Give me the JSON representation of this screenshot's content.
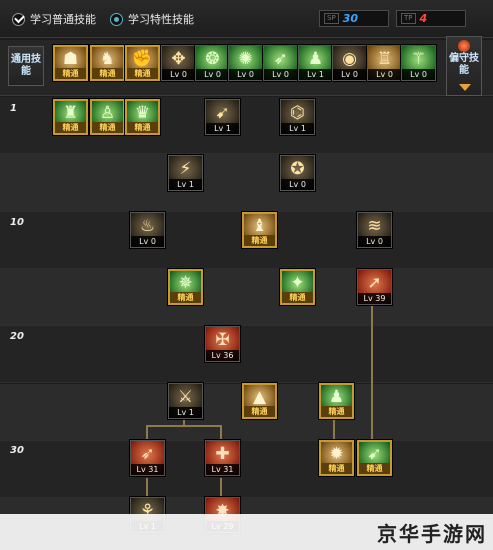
{
  "header": {
    "learn_common": "学习普通技能",
    "learn_trait": "学习特性技能",
    "sp": {
      "label": "SP",
      "value": "30"
    },
    "tp": {
      "label": "TP",
      "value": "4"
    }
  },
  "common_bar": {
    "button_label": "通用技能",
    "skills": [
      {
        "label": "精通",
        "mastered": true,
        "theme": "gold",
        "glyph": "☗"
      },
      {
        "label": "精通",
        "mastered": true,
        "theme": "gold",
        "glyph": "♞"
      },
      {
        "label": "精通",
        "mastered": true,
        "theme": "gold",
        "glyph": "✊"
      },
      {
        "label": "Lv 0",
        "mastered": false,
        "theme": "dark",
        "glyph": "✥"
      },
      {
        "label": "Lv 0",
        "mastered": false,
        "theme": "green",
        "glyph": "❂"
      },
      {
        "label": "Lv 0",
        "mastered": false,
        "theme": "green",
        "glyph": "✺"
      },
      {
        "label": "Lv 0",
        "mastered": false,
        "theme": "green",
        "glyph": "➶"
      },
      {
        "label": "Lv 1",
        "mastered": false,
        "theme": "green",
        "glyph": "♟"
      },
      {
        "label": "Lv 0",
        "mastered": false,
        "theme": "dark",
        "glyph": "◉"
      },
      {
        "label": "Lv 0",
        "mastered": false,
        "theme": "gold",
        "glyph": "♖"
      },
      {
        "label": "Lv 0",
        "mastered": false,
        "theme": "green",
        "glyph": "⚚"
      }
    ],
    "side_button_label": "偏守技能"
  },
  "tree": {
    "level_labels": [
      "1",
      "10",
      "20",
      "30"
    ],
    "skills": [
      {
        "label": "精通",
        "mastered": true,
        "theme": "green",
        "glyph": "♜"
      },
      {
        "label": "精通",
        "mastered": true,
        "theme": "green",
        "glyph": "♙"
      },
      {
        "label": "精通",
        "mastered": true,
        "theme": "green",
        "glyph": "♛"
      },
      {
        "label": "Lv 1",
        "mastered": false,
        "theme": "dark",
        "glyph": "➹"
      },
      {
        "label": "Lv 1",
        "mastered": false,
        "theme": "dark",
        "glyph": "⌬"
      },
      {
        "label": "Lv 1",
        "mastered": false,
        "theme": "dark",
        "glyph": "⚡"
      },
      {
        "label": "Lv 0",
        "mastered": false,
        "theme": "dark",
        "glyph": "✪"
      },
      {
        "label": "Lv 0",
        "mastered": false,
        "theme": "dark",
        "glyph": "♨"
      },
      {
        "label": "精通",
        "mastered": true,
        "theme": "gold",
        "glyph": "♝"
      },
      {
        "label": "Lv 0",
        "mastered": false,
        "theme": "dark",
        "glyph": "≋"
      },
      {
        "label": "精通",
        "mastered": true,
        "theme": "green",
        "glyph": "✵"
      },
      {
        "label": "精通",
        "mastered": true,
        "theme": "green",
        "glyph": "✦"
      },
      {
        "label": "Lv 39",
        "mastered": false,
        "theme": "red",
        "glyph": "➚"
      },
      {
        "label": "Lv 36",
        "mastered": false,
        "theme": "red",
        "glyph": "✠"
      },
      {
        "label": "Lv 1",
        "mastered": false,
        "theme": "dark",
        "glyph": "⚔"
      },
      {
        "label": "精通",
        "mastered": true,
        "theme": "gold",
        "glyph": "▲"
      },
      {
        "label": "精通",
        "mastered": true,
        "theme": "green",
        "glyph": "♟"
      },
      {
        "label": "Lv 31",
        "mastered": false,
        "theme": "red",
        "glyph": "➶"
      },
      {
        "label": "Lv 31",
        "mastered": false,
        "theme": "red",
        "glyph": "✚"
      },
      {
        "label": "精通",
        "mastered": true,
        "theme": "gold",
        "glyph": "✹"
      },
      {
        "label": "精通",
        "mastered": true,
        "theme": "green",
        "glyph": "➹"
      },
      {
        "label": "Lv 1",
        "mastered": false,
        "theme": "dark",
        "glyph": "⚘"
      },
      {
        "label": "Lv 29",
        "mastered": false,
        "theme": "red",
        "glyph": "✸"
      }
    ]
  },
  "watermark": "京华手游网"
}
